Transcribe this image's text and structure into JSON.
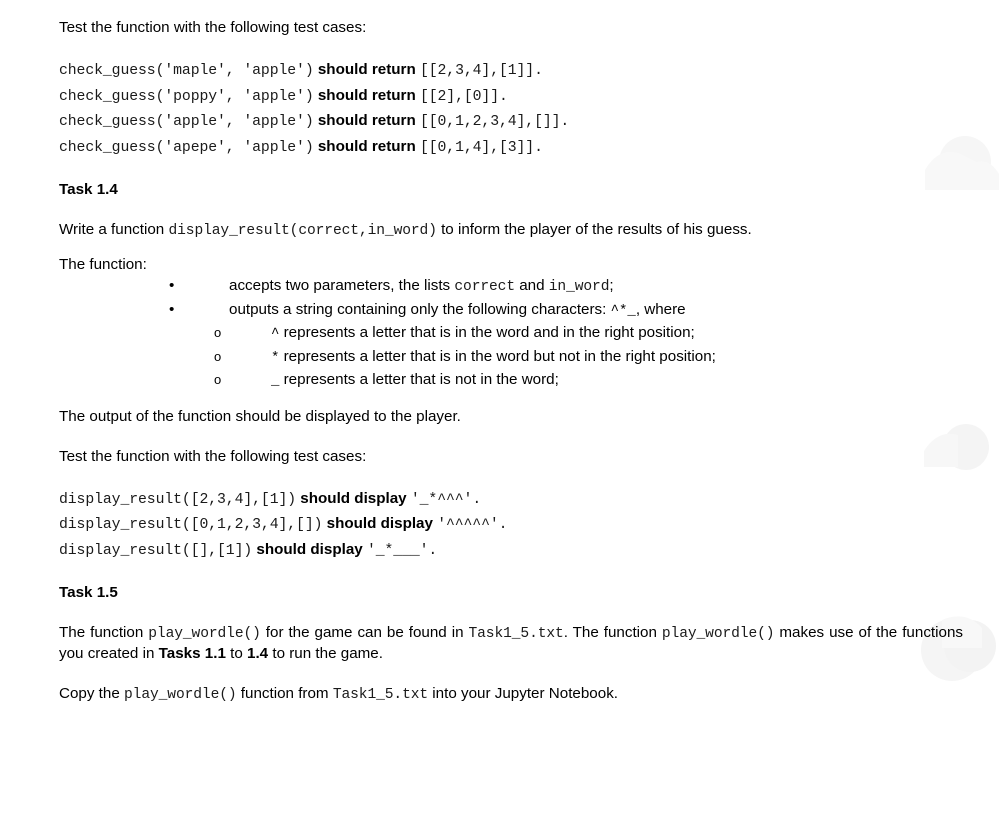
{
  "document": {
    "intro_test_cases_label": "Test the function with the following test cases:",
    "check_guess_tests": [
      {
        "call": "check_guess('maple', 'apple')",
        "verb": "should return",
        "result": "[[2,3,4],[1]].",
        "trailing": ""
      },
      {
        "call": "check_guess('poppy', 'apple')",
        "verb": "should return",
        "result": "[[2],[0]].",
        "trailing": ""
      },
      {
        "call": "check_guess('apple', 'apple')",
        "verb": "should return",
        "result": "[[0,1,2,3,4],[]].",
        "trailing": ""
      },
      {
        "call": "check_guess('apepe', 'apple')",
        "verb": "should return",
        "result": "[[0,1,4],[3]].",
        "trailing": ""
      }
    ],
    "task_1_4": {
      "heading": "Task 1.4",
      "intro_before": "Write a function ",
      "intro_code": "display_result(correct,in_word)",
      "intro_after": " to inform the player of the results of his guess.",
      "function_label": "The function:",
      "bullets": [
        {
          "before": "accepts two parameters, the lists ",
          "code1": "correct",
          "middle": " and ",
          "code2": "in_word",
          "after": ";"
        },
        {
          "before": "outputs a string containing only the following characters: ",
          "code1": "^*_",
          "middle": "",
          "code2": "",
          "after": ", where"
        }
      ],
      "sub_bullets": [
        {
          "symbol": "^",
          "text": " represents a letter that is in the word and in the right position;"
        },
        {
          "symbol": "*",
          "text": " represents a letter that is in the word but not in the right position;"
        },
        {
          "symbol": "_",
          "text": " represents a letter that is not in the word;"
        }
      ],
      "output_note": "The output of the function should be displayed to the player.",
      "test_cases_label": "Test the function with the following test cases:",
      "display_result_tests": [
        {
          "call": "display_result([2,3,4],[1])",
          "verb": "should display",
          "result": "'_*^^^'.",
          "trailing": ""
        },
        {
          "call": "display_result([0,1,2,3,4],[])",
          "verb": "should display",
          "result": "'^^^^^'.",
          "trailing": ""
        },
        {
          "call": "display_result([],[1])",
          "verb": "should display",
          "result": "'_*___'.",
          "trailing": ""
        }
      ]
    },
    "task_1_5": {
      "heading": "Task 1.5",
      "p1_seg1": "The function ",
      "p1_code1": "play_wordle()",
      "p1_seg2": " for the game can be found in ",
      "p1_code2": "Task1_5.txt",
      "p1_seg3": ". The function ",
      "p1_code3": "play_wordle()",
      "p1_seg4": " makes use of the functions you created in ",
      "p1_bold1": "Tasks 1.1",
      "p1_seg5": " to ",
      "p1_bold2": "1.4",
      "p1_seg6": " to run the game.",
      "p2_seg1": "Copy the ",
      "p2_code1": "play_wordle()",
      "p2_seg2": " function from ",
      "p2_code2": "Task1_5.txt",
      "p2_seg3": " into your Jupyter Notebook."
    }
  },
  "watermarks": [
    {
      "name": "watermark-blob-top",
      "color": "#f7f7f7"
    },
    {
      "name": "watermark-blob-middle",
      "color": "#f6f6f6"
    },
    {
      "name": "watermark-blob-bottom",
      "color": "#f5f5f5"
    }
  ]
}
